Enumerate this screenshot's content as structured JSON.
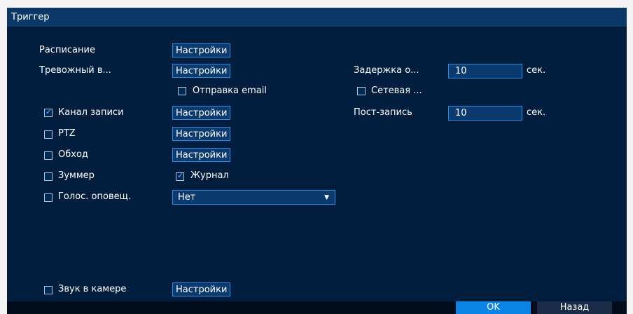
{
  "window": {
    "title": "Триггер"
  },
  "rows": {
    "schedule": {
      "label": "Расписание",
      "button": "Настройки"
    },
    "alarm_out": {
      "label": "Тревожный в...",
      "button": "Настройки"
    },
    "delay": {
      "label": "Задержка о...",
      "value": "10",
      "unit": "сек."
    },
    "send_email": {
      "label": "Отправка email",
      "checked": false
    },
    "network": {
      "label": "Сетевая ...",
      "checked": false
    },
    "record_channel": {
      "label": "Канал записи",
      "button": "Настройки",
      "checked": true
    },
    "post_record": {
      "label": "Пост-запись",
      "value": "10",
      "unit": "сек."
    },
    "ptz": {
      "label": "PTZ",
      "button": "Настройки",
      "checked": false
    },
    "tour": {
      "label": "Обход",
      "button": "Настройки",
      "checked": false
    },
    "buzzer": {
      "label": "Зуммер",
      "checked": false
    },
    "log": {
      "label": "Журнал",
      "checked": true
    },
    "voice": {
      "label": "Голос. оповещ.",
      "checked": false,
      "selected": "Нет"
    },
    "camera_sound": {
      "label": "Звук в камере",
      "button": "Настройки",
      "checked": false
    }
  },
  "footer": {
    "ok": "OK",
    "back": "Назад"
  },
  "colors": {
    "background": "#011e3f",
    "titlebar": "#0b3866",
    "accent": "#2c8de0",
    "ok_button": "#0b84e8",
    "back_button": "#1a2c46"
  }
}
